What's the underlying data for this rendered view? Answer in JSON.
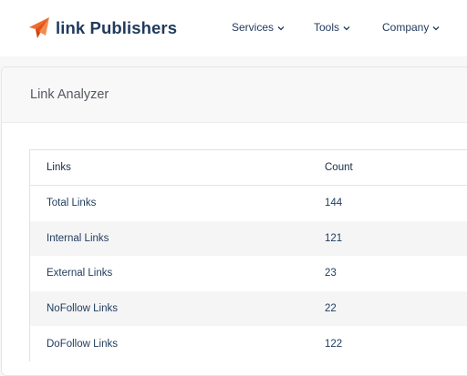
{
  "brand": {
    "name": "link Publishers",
    "accent": "#f26a2b",
    "text_color": "#1f3a5c"
  },
  "nav": [
    {
      "label": "Services",
      "icon": "chevron-down-icon"
    },
    {
      "label": "Tools",
      "icon": "chevron-down-icon"
    },
    {
      "label": "Company",
      "icon": "chevron-down-icon"
    }
  ],
  "card": {
    "title": "Link Analyzer"
  },
  "table": {
    "columns": [
      "Links",
      "Count"
    ],
    "rows": [
      {
        "label": "Total Links",
        "count": "144"
      },
      {
        "label": "Internal Links",
        "count": "121"
      },
      {
        "label": "External Links",
        "count": "23"
      },
      {
        "label": "NoFollow Links",
        "count": "22"
      },
      {
        "label": "DoFollow Links",
        "count": "122"
      }
    ]
  }
}
